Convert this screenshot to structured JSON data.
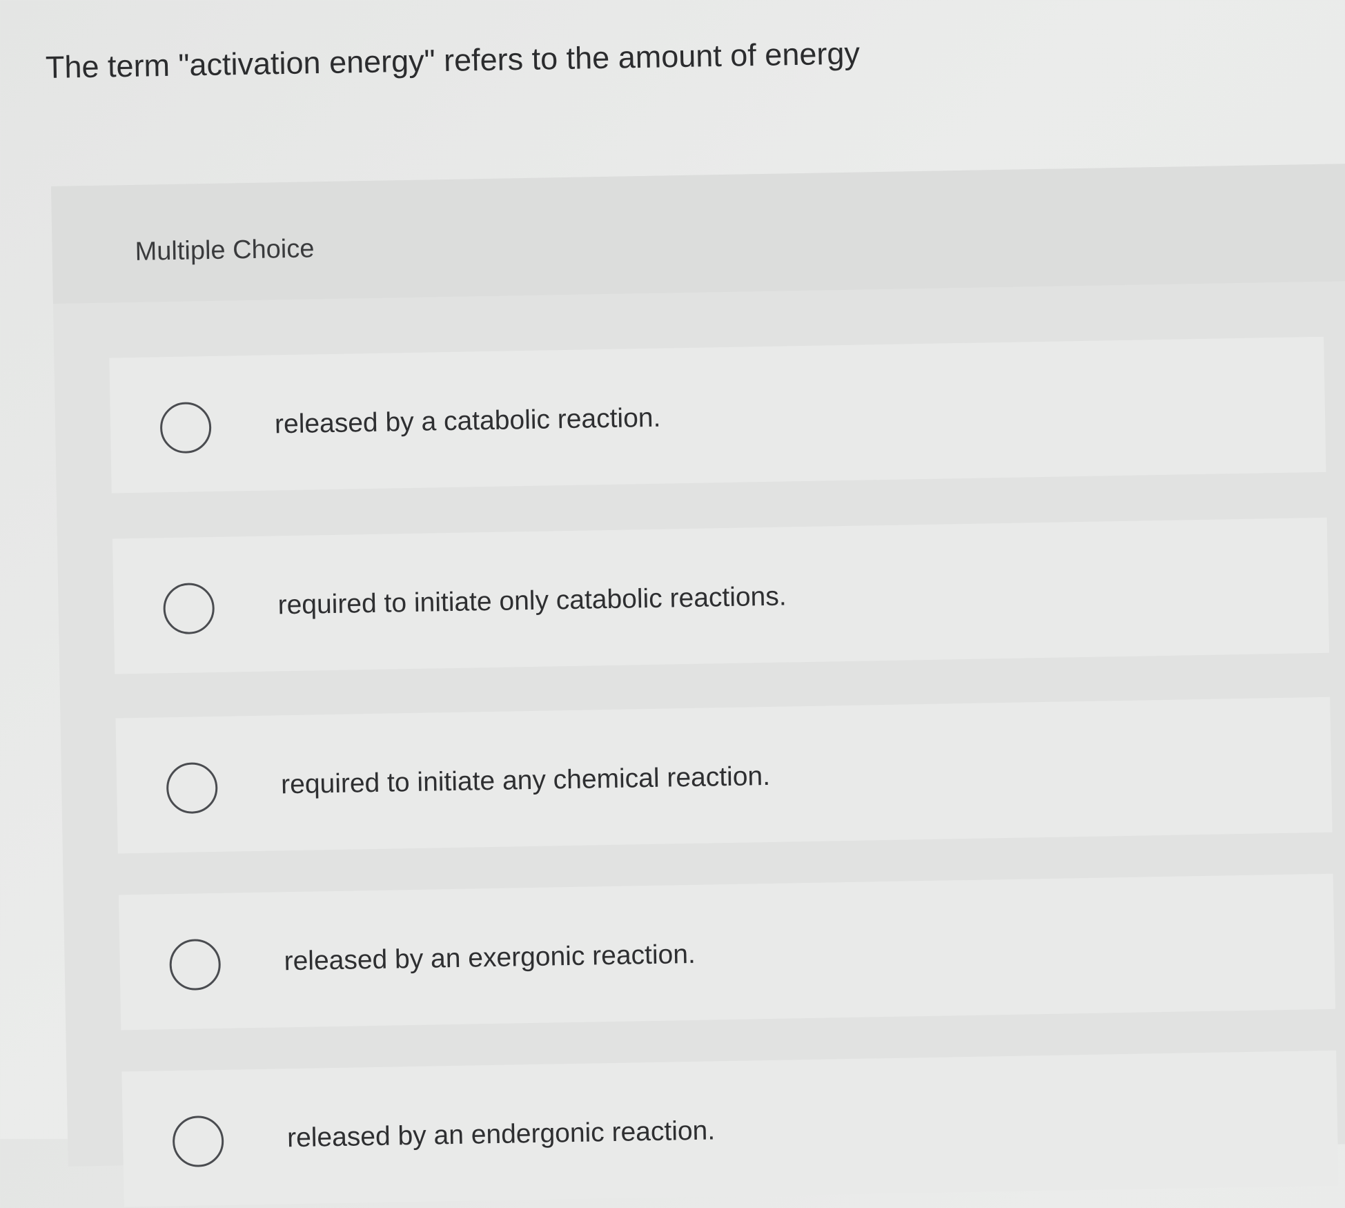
{
  "question": {
    "text": "The term \"activation energy\" refers to the amount of energy"
  },
  "question_type": {
    "label": "Multiple Choice"
  },
  "options": [
    {
      "label": "released by a catabolic reaction."
    },
    {
      "label": "required to initiate only catabolic reactions."
    },
    {
      "label": "required to initiate any chemical reaction."
    },
    {
      "label": "released by an exergonic reaction."
    },
    {
      "label": "released by an endergonic reaction."
    }
  ],
  "colors": {
    "background": "#e8e9e8",
    "panel": "#e1e2e1",
    "option_card": "#e9eae9",
    "radio_border": "#4a4c50",
    "text": "#2e2f31"
  }
}
